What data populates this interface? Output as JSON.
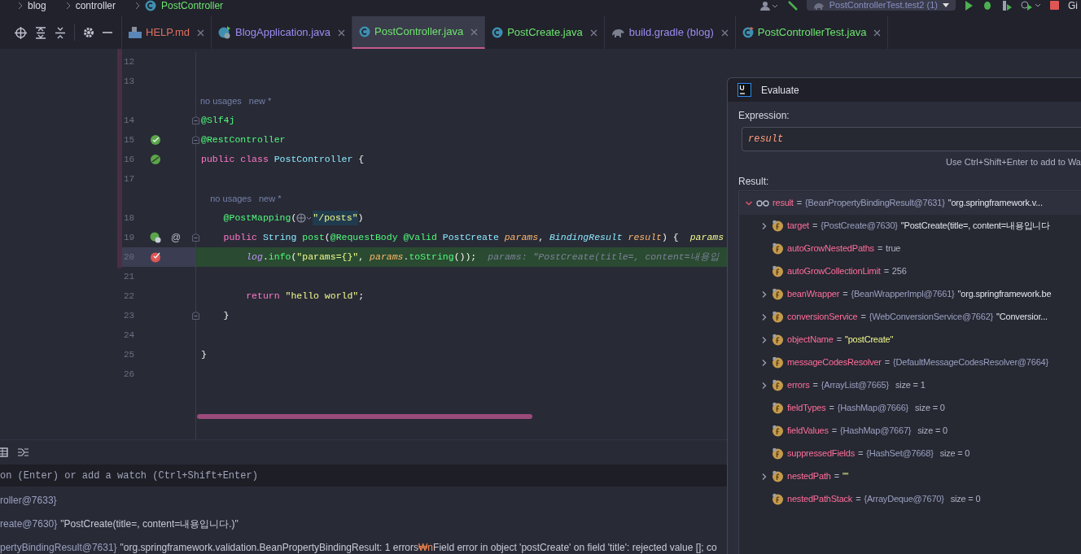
{
  "breadcrumbs": [
    {
      "label": "blog",
      "kind": "folder"
    },
    {
      "label": "controller",
      "kind": "folder"
    },
    {
      "label": "PostController",
      "kind": "class"
    }
  ],
  "run_config": {
    "label": "PostControllerTest.test2 (1)"
  },
  "toolbar_edge_text": "Gi",
  "tabs": [
    {
      "label": "HELP.md",
      "kind": "markdown",
      "color": "#e0705f",
      "selected": false
    },
    {
      "label": "BlogApplication.java",
      "kind": "spring-class",
      "color": "#9d8cf0",
      "selected": false
    },
    {
      "label": "PostController.java",
      "kind": "class",
      "color": "#6ee36e",
      "selected": true
    },
    {
      "label": "PostCreate.java",
      "kind": "class",
      "color": "#6ee36e",
      "selected": false
    },
    {
      "label": "build.gradle (blog)",
      "kind": "gradle",
      "color": "#9d8cf0",
      "selected": false
    },
    {
      "label": "PostControllerTest.java",
      "kind": "test-class",
      "color": "#6ee36e",
      "selected": false
    }
  ],
  "editor": {
    "lines": [
      {
        "kind": "code",
        "number": "12"
      },
      {
        "kind": "code",
        "number": "13"
      },
      {
        "kind": "hint",
        "segments": [
          {
            "kind": "hint",
            "text": "no usages"
          },
          {
            "kind": "hint",
            "text": "new *"
          }
        ]
      },
      {
        "kind": "code",
        "number": "14",
        "fold": true,
        "segments": [
          {
            "kind": "ann",
            "text": "@Slf4j"
          }
        ]
      },
      {
        "kind": "code",
        "number": "15",
        "fold": true,
        "gutter": {
          "kind": "bean-check"
        },
        "segments": [
          {
            "kind": "ann",
            "text": "@RestController"
          }
        ]
      },
      {
        "kind": "code",
        "number": "16",
        "gutter": {
          "kind": "bean"
        },
        "segments": [
          {
            "kind": "kw",
            "text": "public class "
          },
          {
            "kind": "type",
            "text": "PostController"
          },
          {
            "kind": "plain",
            "text": " {"
          }
        ]
      },
      {
        "kind": "code",
        "number": "17"
      },
      {
        "kind": "hint",
        "segments": [
          {
            "kind": "hint",
            "text": "    no usages"
          },
          {
            "kind": "hint",
            "text": "new *"
          }
        ]
      },
      {
        "kind": "code",
        "number": "18",
        "segments": [
          {
            "kind": "ann",
            "text": "    @PostMapping"
          },
          {
            "kind": "plain",
            "text": "("
          },
          {
            "kind": "icon"
          },
          {
            "kind": "str-hl",
            "text": "\"/posts\""
          },
          {
            "kind": "plain",
            "text": ")"
          }
        ]
      },
      {
        "kind": "code",
        "number": "19",
        "fold": true,
        "gutter": {
          "kind": "bean-web"
        },
        "marker": "@",
        "segments": [
          {
            "kind": "kw",
            "text": "    public "
          },
          {
            "kind": "type",
            "text": "String "
          },
          {
            "kind": "fn",
            "text": "post"
          },
          {
            "kind": "plain",
            "text": "("
          },
          {
            "kind": "ann",
            "text": "@RequestBody @Valid "
          },
          {
            "kind": "type",
            "text": "PostCreate "
          },
          {
            "kind": "param",
            "text": "params"
          },
          {
            "kind": "plain",
            "text": ", "
          },
          {
            "kind": "type-i",
            "text": "BindingResult "
          },
          {
            "kind": "param-i",
            "text": "result"
          },
          {
            "kind": "plain",
            "text": ") {"
          },
          {
            "kind": "inline-name",
            "text": "params"
          }
        ]
      },
      {
        "kind": "code",
        "number": "20",
        "current": true,
        "gutter": {
          "kind": "breakpoint"
        },
        "segments": [
          {
            "kind": "field",
            "text": "        log"
          },
          {
            "kind": "plain",
            "text": "."
          },
          {
            "kind": "fn",
            "text": "info"
          },
          {
            "kind": "plain",
            "text": "("
          },
          {
            "kind": "str",
            "text": "\"params={}\""
          },
          {
            "kind": "plain",
            "text": ", "
          },
          {
            "kind": "param",
            "text": "params"
          },
          {
            "kind": "plain",
            "text": "."
          },
          {
            "kind": "fn",
            "text": "toString"
          },
          {
            "kind": "plain",
            "text": "());"
          },
          {
            "kind": "inline",
            "text": "params: \"PostCreate(title=, content=내용입"
          }
        ]
      },
      {
        "kind": "code",
        "number": "21"
      },
      {
        "kind": "code",
        "number": "22",
        "segments": [
          {
            "kind": "kw",
            "text": "        return "
          },
          {
            "kind": "str",
            "text": "\"hello world\""
          },
          {
            "kind": "plain",
            "text": ";"
          }
        ]
      },
      {
        "kind": "code",
        "number": "23",
        "fold": true,
        "segments": [
          {
            "kind": "plain",
            "text": "    }"
          }
        ]
      },
      {
        "kind": "code",
        "number": "24"
      },
      {
        "kind": "code",
        "number": "25",
        "segments": [
          {
            "kind": "plain",
            "text": "}"
          }
        ]
      },
      {
        "kind": "code",
        "number": "26"
      }
    ]
  },
  "debugger": {
    "watch_placeholder": "on (Enter) or add a watch (Ctrl+Shift+Enter)",
    "rows": [
      [
        {
          "kind": "ref",
          "text": "roller@7633}"
        }
      ],
      [
        {
          "kind": "ref",
          "text": "reate@7630}"
        },
        {
          "kind": "str",
          "text": "\"PostCreate(title=, content=내용입니다.)\""
        }
      ],
      [
        {
          "kind": "ref",
          "text": "pertyBindingResult@7631}"
        },
        {
          "kind": "str",
          "text": "\"org.springframework.validation.BeanPropertyBindingResult: 1 errors"
        },
        {
          "kind": "escape",
          "text": "₩n"
        },
        {
          "kind": "str",
          "text": "Field error in object 'postCreate' on field 'title': rejected value []; co"
        }
      ]
    ]
  },
  "evaluate": {
    "title": "Evaluate",
    "expression_label": "Expression:",
    "expression": "result",
    "hint": "Use Ctrl+Shift+Enter to add to Wa",
    "result_label": "Result:",
    "root": {
      "name": "result",
      "equals": "=",
      "ref": "{BeanPropertyBindingResult@7631}",
      "text": "\"org.springframework.v...",
      "expanded": true,
      "children": [
        {
          "name": "target",
          "equals": "=",
          "expandable": true,
          "ref": "{PostCreate@7630}",
          "text": "\"PostCreate(title=, content=내용입니다"
        },
        {
          "name": "autoGrowNestedPaths",
          "equals": "=",
          "expandable": false,
          "literal": "true"
        },
        {
          "name": "autoGrowCollectionLimit",
          "equals": "=",
          "expandable": false,
          "literal": "256"
        },
        {
          "name": "beanWrapper",
          "equals": "=",
          "expandable": true,
          "ref": "{BeanWrapperImpl@7661}",
          "text": "\"org.springframework.be"
        },
        {
          "name": "conversionService",
          "equals": "=",
          "expandable": true,
          "ref": "{WebConversionService@7662}",
          "text": "\"Conversior..."
        },
        {
          "name": "objectName",
          "equals": "=",
          "expandable": true,
          "string": "\"postCreate\""
        },
        {
          "name": "messageCodesResolver",
          "equals": "=",
          "expandable": true,
          "ref": "{DefaultMessageCodesResolver@7664}"
        },
        {
          "name": "errors",
          "equals": "=",
          "expandable": true,
          "ref": "{ArrayList@7665}",
          "extra": "size = 1"
        },
        {
          "name": "fieldTypes",
          "equals": "=",
          "expandable": false,
          "ref": "{HashMap@7666}",
          "extra": "size = 0"
        },
        {
          "name": "fieldValues",
          "equals": "=",
          "expandable": false,
          "ref": "{HashMap@7667}",
          "extra": "size = 0"
        },
        {
          "name": "suppressedFields",
          "equals": "=",
          "expandable": false,
          "ref": "{HashSet@7668}",
          "extra": "size = 0"
        },
        {
          "name": "nestedPath",
          "equals": "=",
          "expandable": true,
          "string": "\"\""
        },
        {
          "name": "nestedPathStack",
          "equals": "=",
          "expandable": false,
          "ref": "{ArrayDeque@7670}",
          "extra": "size = 0"
        }
      ]
    }
  }
}
